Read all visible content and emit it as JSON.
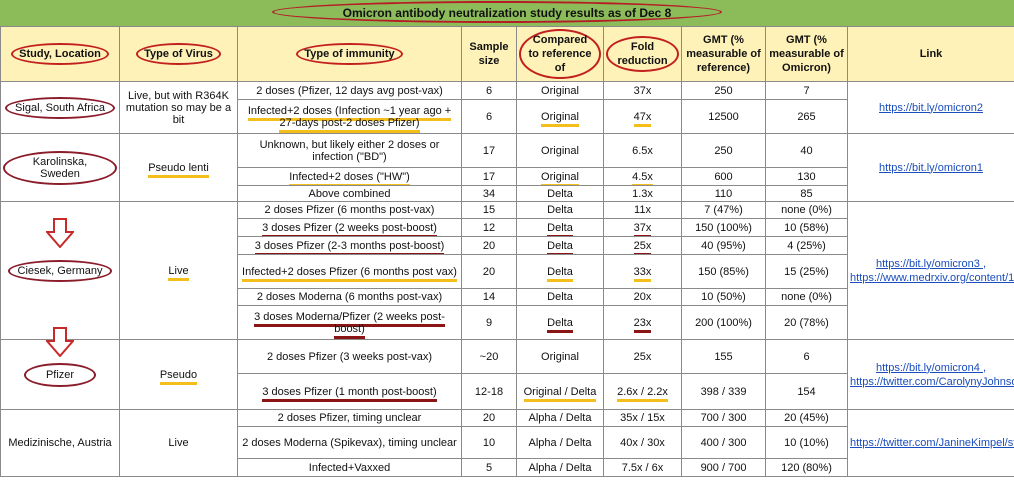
{
  "title": "Omicron antibody neutralization study results as of Dec 8",
  "headers": {
    "study": "Study, Location",
    "virus": "Type of Virus",
    "immunity": "Type of immunity",
    "sample": "Sample size",
    "compared": "Compared to reference of",
    "fold": "Fold reduction",
    "gmt_ref": "GMT (% measurable of reference)",
    "gmt_omi": "GMT (% measurable of Omicron)",
    "link": "Link"
  },
  "groups": {
    "sigal": {
      "study": "Sigal, South Africa",
      "virus": "Live, but with R364K mutation so may be a bit",
      "link": "https://bit.ly/omicron2"
    },
    "karolinska": {
      "study": "Karolinska, Sweden",
      "virus": "Pseudo lenti",
      "link": "https://bit.ly/omicron1"
    },
    "ciesek": {
      "study": "Ciesek, Germany",
      "virus": "Live",
      "link": "https://bit.ly/omicron3 , https://www.medrxiv.org/content/10.1101/2021.12.07.21267432v1"
    },
    "pfizer": {
      "study": "Pfizer",
      "virus": "Pseudo",
      "link": "https://bit.ly/omicron4 , https://twitter.com/CarolynyJohnson/status/1468583768961130501"
    },
    "medizin": {
      "study": "Medizinische, Austria",
      "virus": "Live",
      "link": "https://twitter.com/JanineKimpel/status/1468700628922904591/photo/1"
    }
  },
  "rows": [
    {
      "immunity": "2 doses (Pfizer, 12 days avg post-vax)",
      "sample": "6",
      "compared": "Original",
      "fold": "37x",
      "gmt_ref": "250",
      "gmt_omi": "7"
    },
    {
      "immunity": "Infected+2 doses (Infection ~1 year ago + 27-days post-2 doses Pfizer)",
      "sample": "6",
      "compared": "Original",
      "fold": "47x",
      "gmt_ref": "12500",
      "gmt_omi": "265"
    },
    {
      "immunity": "Unknown, but likely either 2 doses or infection (\"BD\")",
      "sample": "17",
      "compared": "Original",
      "fold": "6.5x",
      "gmt_ref": "250",
      "gmt_omi": "40"
    },
    {
      "immunity": "Infected+2 doses (\"HW\")",
      "sample": "17",
      "compared": "Original",
      "fold": "4.5x",
      "gmt_ref": "600",
      "gmt_omi": "130"
    },
    {
      "immunity": "Above combined",
      "sample": "34",
      "compared": "Delta",
      "fold": "1.3x",
      "gmt_ref": "110",
      "gmt_omi": "85"
    },
    {
      "immunity": "2 doses Pfizer (6 months post-vax)",
      "sample": "15",
      "compared": "Delta",
      "fold": "11x",
      "gmt_ref": "7 (47%)",
      "gmt_omi": "none (0%)"
    },
    {
      "immunity": "3 doses Pfizer (2 weeks post-boost)",
      "sample": "12",
      "compared": "Delta",
      "fold": "37x",
      "gmt_ref": "150 (100%)",
      "gmt_omi": "10 (58%)"
    },
    {
      "immunity": "3 doses Pfizer (2-3 months post-boost)",
      "sample": "20",
      "compared": "Delta",
      "fold": "25x",
      "gmt_ref": "40 (95%)",
      "gmt_omi": "4 (25%)"
    },
    {
      "immunity": "Infected+2 doses Pfizer (6 months post vax)",
      "sample": "20",
      "compared": "Delta",
      "fold": "33x",
      "gmt_ref": "150 (85%)",
      "gmt_omi": "15 (25%)"
    },
    {
      "immunity": "2 doses Moderna (6 months post-vax)",
      "sample": "14",
      "compared": "Delta",
      "fold": "20x",
      "gmt_ref": "10 (50%)",
      "gmt_omi": "none (0%)"
    },
    {
      "immunity": "3 doses Moderna/Pfizer (2 weeks post-boost)",
      "sample": "9",
      "compared": "Delta",
      "fold": "23x",
      "gmt_ref": "200 (100%)",
      "gmt_omi": "20 (78%)"
    },
    {
      "immunity": "2 doses Pfizer (3 weeks post-vax)",
      "sample": "~20",
      "compared": "Original",
      "fold": "25x",
      "gmt_ref": "155",
      "gmt_omi": "6"
    },
    {
      "immunity": "3 doses Pfizer (1 month post-boost)",
      "sample": "12-18",
      "compared": "Original / Delta",
      "fold": "2.6x / 2.2x",
      "gmt_ref": "398  / 339",
      "gmt_omi": "154"
    },
    {
      "immunity": "2 doses Pfizer, timing unclear",
      "sample": "20",
      "compared": "Alpha / Delta",
      "fold": "35x / 15x",
      "gmt_ref": "700 / 300",
      "gmt_omi": "20 (45%)"
    },
    {
      "immunity": "2 doses Moderna (Spikevax), timing unclear",
      "sample": "10",
      "compared": "Alpha / Delta",
      "fold": "40x / 30x",
      "gmt_ref": "400 / 300",
      "gmt_omi": "10 (10%)"
    },
    {
      "immunity": "Infected+Vaxxed",
      "sample": "5",
      "compared": "Alpha / Delta",
      "fold": "7.5x / 6x",
      "gmt_ref": "900 / 700",
      "gmt_omi": "120 (80%)"
    }
  ],
  "colors": {
    "title_bg": "#8cbc5a",
    "header_bg": "#fff2b8",
    "highlight_yellow": "#f4bf1a",
    "highlight_red": "#8b1414",
    "link": "#1a4dbd"
  },
  "icons": [
    "down-arrow-icon",
    "down-arrow-icon"
  ]
}
